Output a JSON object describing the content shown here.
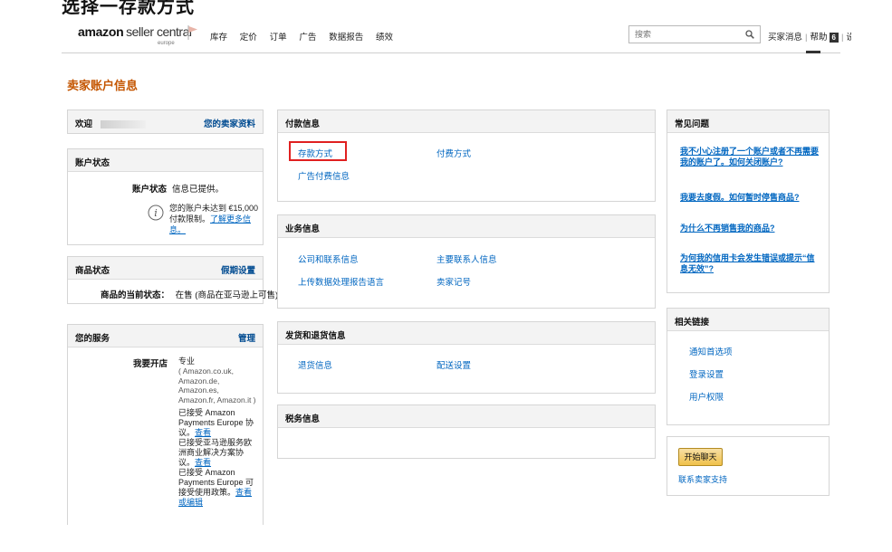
{
  "caption": "选择一存款方式",
  "header": {
    "logo_amazon": "amazon",
    "logo_seller": "seller central",
    "logo_region": "europe",
    "nav": [
      "库存",
      "定价",
      "订单",
      "广告",
      "数据报告",
      "绩效"
    ],
    "search_placeholder": "搜索",
    "buyer_messages": "买家消息",
    "help": "帮助",
    "help_badge": "6",
    "settings": "设置"
  },
  "page_title": "卖家账户信息",
  "welcome": {
    "label": "欢迎",
    "link": "您的卖家资料"
  },
  "account_status": {
    "title": "账户状态",
    "label": "账户状态",
    "value": "信息已提供。",
    "notice": "您的账户未达到 €15,000 付款限制。",
    "notice_link": "了解更多信息。"
  },
  "listing_status": {
    "title": "商品状态",
    "action": "假期设置",
    "label": "商品的当前状态：",
    "value": "在售 (商品在亚马逊上可售)"
  },
  "services": {
    "title": "您的服务",
    "action": "管理",
    "label": "我要开店",
    "plan": "专业",
    "marketplaces": "( Amazon.co.uk, Amazon.de, Amazon.es, Amazon.fr, Amazon.it )",
    "agreement1": "已接受 Amazon Payments Europe 协议。",
    "agreement1_link": "查看",
    "agreement2": "已接受亚马逊服务欧洲商业解决方案协议。",
    "agreement2_link": "查看",
    "agreement3": "已接受 Amazon Payments Europe 可接受使用政策。",
    "agreement3_link": "查看或编辑"
  },
  "payment_info": {
    "title": "付款信息",
    "deposit_method": "存款方式",
    "charge_method": "付费方式",
    "ad_payment": "广告付费信息"
  },
  "business_info": {
    "title": "业务信息",
    "company_address": "公司和联系信息",
    "primary_contact": "主要联系人信息",
    "upload_language": "上传数据处理报告语言",
    "seller_token": "卖家记号"
  },
  "shipping_returns": {
    "title": "发货和退货信息",
    "returns": "退货信息",
    "shipping_settings": "配送设置"
  },
  "tax_info": {
    "title": "税务信息"
  },
  "faq": {
    "title": "常见问题",
    "items": [
      "我不小心注册了一个账户或者不再需要我的账户了。如何关闭账户?",
      "我要去度假。如何暂时停售商品?",
      "为什么不再销售我的商品?",
      "为何我的信用卡会发生错误或提示“信息无效”?"
    ]
  },
  "related_links": {
    "title": "相关链接",
    "items": [
      "通知首选项",
      "登录设置",
      "用户权限"
    ]
  },
  "chat": {
    "button": "开始聊天",
    "support": "联系卖家支持"
  },
  "colors": {
    "title_orange": "#c45500",
    "link_blue": "#0066c0",
    "highlight_red": "#e02020"
  }
}
